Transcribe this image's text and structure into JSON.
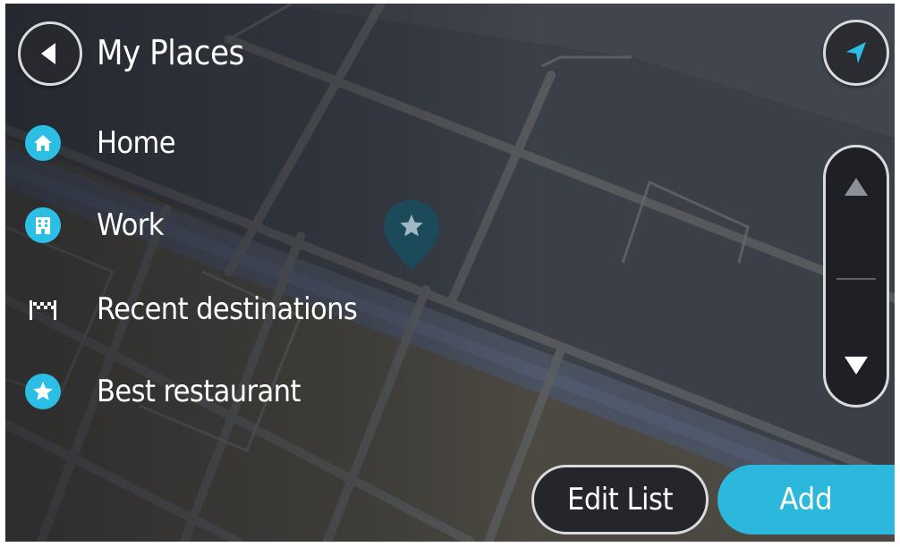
{
  "header": {
    "title": "My Places"
  },
  "places": [
    {
      "label": "Home",
      "icon": "home-icon"
    },
    {
      "label": "Work",
      "icon": "building-icon"
    },
    {
      "label": "Recent destinations",
      "icon": "checkered-flag-icon"
    },
    {
      "label": "Best restaurant",
      "icon": "star-icon"
    }
  ],
  "actions": {
    "edit_label": "Edit List",
    "add_label": "Add"
  },
  "colors": {
    "accent": "#2bbfe6",
    "button_dark": "#25262b",
    "border_light": "#d9dadc",
    "map_background": "#383c45",
    "pin": "#1b4a5a"
  }
}
